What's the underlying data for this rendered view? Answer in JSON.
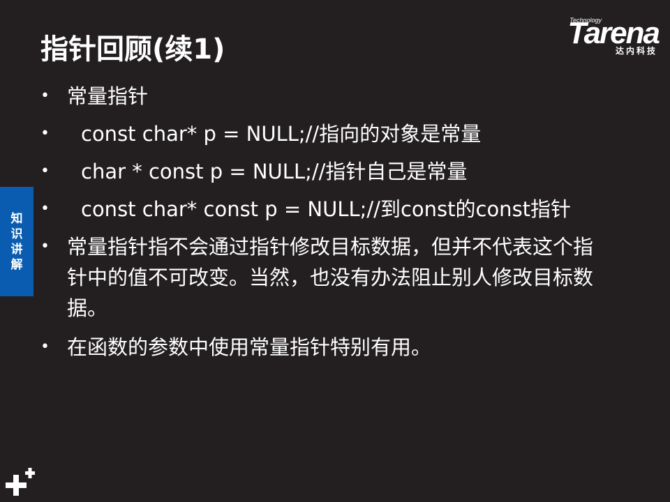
{
  "slide": {
    "title": "指针回顾(续1)",
    "logo": {
      "tech_label": "Technology",
      "brand": "Tarena",
      "subtitle": "达内科技"
    },
    "side_tab": [
      "知",
      "识",
      "讲",
      "解"
    ],
    "bullets": [
      "常量指针",
      "const char* p = NULL;//指向的对象是常量",
      "char * const p = NULL;//指针自己是常量",
      "const char* const p = NULL;//到const的const指针",
      "常量指针指不会通过指针修改目标数据，但并不代表这个指针中的值不可改变。当然，也没有办法阻止别人修改目标数据。",
      "在函数的参数中使用常量指针特别有用。"
    ],
    "bullet_char": "•",
    "colors": {
      "background": "#231f20",
      "text": "#ffffff",
      "side_tab": "#0a5cb0"
    }
  }
}
